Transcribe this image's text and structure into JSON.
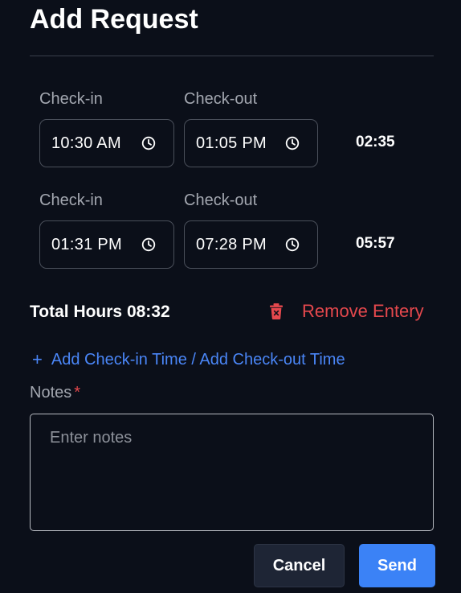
{
  "dialog": {
    "title": "Add Request"
  },
  "entries": [
    {
      "checkin_label": "Check-in",
      "checkout_label": "Check-out",
      "checkin_value": "10:30 AM",
      "checkout_value": "01:05 PM",
      "duration": "02:35"
    },
    {
      "checkin_label": "Check-in",
      "checkout_label": "Check-out",
      "checkin_value": "01:31 PM",
      "checkout_value": "07:28 PM",
      "duration": "05:57"
    }
  ],
  "summary": {
    "total_text": "Total Hours 08:32",
    "remove_label": "Remove Entery"
  },
  "add_time": {
    "plus": "+",
    "label": "Add Check-in Time / Add Check-out Time"
  },
  "notes": {
    "label": "Notes",
    "required_mark": "*",
    "placeholder": "Enter notes",
    "value": ""
  },
  "actions": {
    "cancel_label": "Cancel",
    "send_label": "Send"
  },
  "icons": {
    "time": "clock-icon",
    "remove": "trash-icon",
    "add": "plus-icon"
  },
  "colors": {
    "background": "#0b0f19",
    "danger": "#e5484d",
    "link": "#4a86f7",
    "primary": "#3b82f6",
    "secondary_button": "#1e2535"
  }
}
